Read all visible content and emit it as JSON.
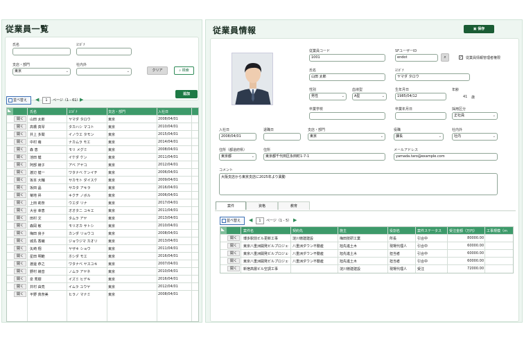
{
  "left": {
    "title": "従業員一覧",
    "search": {
      "name_label": "氏名",
      "kana_label": "ﾖﾐｶﾞﾅ",
      "branch_label": "支店・部門",
      "branch_value": "東京",
      "inout_label": "社内外",
      "clear_label": "クリア",
      "search_label": "検索"
    },
    "add_label": "追加",
    "pager": {
      "sort_label": "並べ替え",
      "page": "1",
      "page_text": "ページ（1 - 61）"
    },
    "columns": [
      "氏名",
      "ﾖﾐｶﾞﾅ",
      "支店・部門",
      "入社日"
    ],
    "open_label": "開く",
    "rows": [
      [
        "山田 太郎",
        "ヤマダ タロウ",
        "東京",
        "2008/04/01"
      ],
      [
        "高橋 真琴",
        "タカハシ マコト",
        "東京",
        "2010/04/01"
      ],
      [
        "井上 多聞",
        "イノウエ タモン",
        "東京",
        "2015/04/01"
      ],
      [
        "中村 萌",
        "ナカムラ モエ",
        "東京",
        "2014/04/01"
      ],
      [
        "森 恵",
        "モリ メグミ",
        "東京",
        "2008/04/01"
      ],
      [
        "池田 健",
        "イケダ ケン",
        "東京",
        "2011/04/01"
      ],
      [
        "阿部 綾子",
        "アベ アヤコ",
        "東京",
        "2012/04/01"
      ],
      [
        "渡辺 健一",
        "ワタナベ ケンイチ",
        "東京",
        "2006/04/01"
      ],
      [
        "坂本 大輔",
        "サカモト ダイスケ",
        "東京",
        "2009/04/01"
      ],
      [
        "坂田 晶",
        "サカタ アキラ",
        "東京",
        "2016/04/01"
      ],
      [
        "菊地 昇",
        "キクチ ノボル",
        "東京",
        "2006/04/01"
      ],
      [
        "上田 莉奈",
        "ウエダ リナ",
        "東京",
        "2017/04/01"
      ],
      [
        "大谷 幸恵",
        "オオタニ ユキエ",
        "東京",
        "2011/04/01"
      ],
      [
        "田村 文",
        "タムラ アヤ",
        "東京",
        "2013/04/01"
      ],
      [
        "森岡 敏",
        "モリオカ サトシ",
        "東京",
        "2010/04/01"
      ],
      [
        "梅田 良子",
        "カンダ リョウコ",
        "東京",
        "2008/04/01"
      ],
      [
        "城島 香織",
        "ジョウジマ カオリ",
        "東京",
        "2013/04/01"
      ],
      [
        "矢崎 翔",
        "ヤザキ ショウ",
        "東京",
        "2011/04/01"
      ],
      [
        "星田 明範",
        "ホシダ モエ",
        "東京",
        "2016/04/01"
      ],
      [
        "渡邊 恭之",
        "ワタナベ ヤスユキ",
        "東京",
        "2007/04/01"
      ],
      [
        "野村 綾音",
        "ノムラ アヤネ",
        "東京",
        "2010/04/01"
      ],
      [
        "泉 秀樹",
        "イズミ ヒデキ",
        "東京",
        "2016/04/01"
      ],
      [
        "井村 由亮",
        "イムラ ユウヤ",
        "東京",
        "2012/04/01"
      ],
      [
        "平野 真奈美",
        "ヒラノ マナミ",
        "東京",
        "2008/04/01"
      ]
    ]
  },
  "right": {
    "title": "従業員情報",
    "save_label": "保存",
    "fields": {
      "empcode_label": "従業員コード",
      "empcode": "1001",
      "sfuser_label": "SFユーザーID",
      "sfuser": "endot",
      "admin_label": "従業員情報管理者権限",
      "name_label": "氏名",
      "name": "山田 太郎",
      "kana_label": "ﾖﾐｶﾞﾅ",
      "kana": "ヤマダ タロウ",
      "gender_label": "性別",
      "gender": "男性",
      "blood_label": "血液型",
      "blood": "A型",
      "birth_label": "生年月日",
      "birth": "1985/04/12",
      "age_label": "年齢",
      "age": "41",
      "age_unit": "歳",
      "school_label": "卒業学校",
      "gradyear_label": "卒業年月日",
      "hire_type_label": "採用区分",
      "hire_type": "正社員",
      "join_label": "入社日",
      "join": "2008/04/01",
      "retire_label": "退職日",
      "branch_label": "支店・部門",
      "branch": "東京",
      "position_label": "役職",
      "position": "課長",
      "inout_label": "社内外",
      "inout": "社内",
      "pref_label": "住所（都道府県）",
      "pref": "東京都",
      "address_label": "住所",
      "address": "東京都千代田区永田町1-7-1",
      "email_label": "メールアドレス",
      "email": "yamada.taro@example.com",
      "comment_label": "コメント",
      "comment": "大阪支店から東京支店に2025年より異動"
    },
    "tabs": [
      "案件",
      "資格",
      "教育"
    ],
    "pager": {
      "sort_label": "並べ替え",
      "page": "1",
      "page_text": "ページ（1 - 5）"
    },
    "columns": [
      "案件名",
      "契約先",
      "施主",
      "役割名",
      "案件ステータス",
      "受注金額（万円）",
      "工事規模（m"
    ],
    "open_label": "開く",
    "rows": [
      [
        "博多駅前ビル更新工事",
        "淀川徳建建設",
        "梅田技研工業",
        "所長",
        "引合中",
        "80000.00"
      ],
      [
        "東京八重洲開発ビルプロジェク",
        "八重洲ダウン不動産",
        "旭先進土木",
        "現場代理人",
        "引合中",
        "60000.00"
      ],
      [
        "東京八重洲開発ビルプロジェク",
        "八重洲ダウン不動産",
        "旭先進土木",
        "担当者",
        "引合中",
        "60000.00"
      ],
      [
        "東京八重洲開発ビルプロジェク",
        "八重洲ダウン不動産",
        "旭先進土木",
        "担当者",
        "引合中",
        "60000.00"
      ],
      [
        "新宿高層ビル空調工事",
        "",
        "淀川徳建建設",
        "現場代理人",
        "受注",
        "72000.00"
      ]
    ]
  }
}
